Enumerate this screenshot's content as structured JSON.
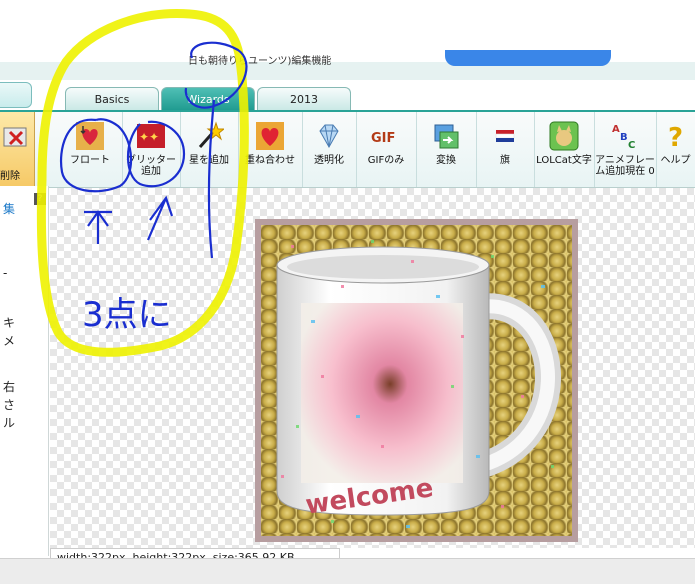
{
  "header": {
    "caption": "日も朝待りらユーンツ)編集機能"
  },
  "tabs": [
    {
      "label": "Basics"
    },
    {
      "label": "Wizards"
    },
    {
      "label": "2013"
    }
  ],
  "toolbar": {
    "delete_label": "削除",
    "tools": [
      {
        "label": "フロート",
        "icon": "float-hearts-icon"
      },
      {
        "label": "グリッター追加",
        "icon": "glitter-icon"
      },
      {
        "label": "星を追加",
        "icon": "magic-wand-icon"
      },
      {
        "label": "重ね合わせ",
        "icon": "overlay-heart-icon"
      },
      {
        "label": "透明化",
        "icon": "diamond-icon"
      },
      {
        "label": "GIFのみ",
        "icon": "gif-icon"
      },
      {
        "label": "変換",
        "icon": "convert-icon"
      },
      {
        "label": "旗",
        "icon": "flag-icon"
      },
      {
        "label": "LOLCat文字",
        "icon": "lolcat-icon"
      },
      {
        "label": "アニメフレーム追加現在 0",
        "icon": "abc-icon"
      },
      {
        "label": "ヘルプ",
        "icon": "help-icon"
      }
    ]
  },
  "sidebar": {
    "chars": [
      "集",
      "-",
      "キ",
      "メ",
      "右",
      "さ",
      "ル"
    ]
  },
  "image": {
    "mug_text": "welcome"
  },
  "status": {
    "dimensions": "width:322px, height:322px, size:365.92 KB"
  },
  "annotation": {
    "handwritten_note": "3点に"
  },
  "colors": {
    "accent": "#2aa397",
    "highlight": "#f0f000",
    "pen": "#1a2ed0"
  }
}
